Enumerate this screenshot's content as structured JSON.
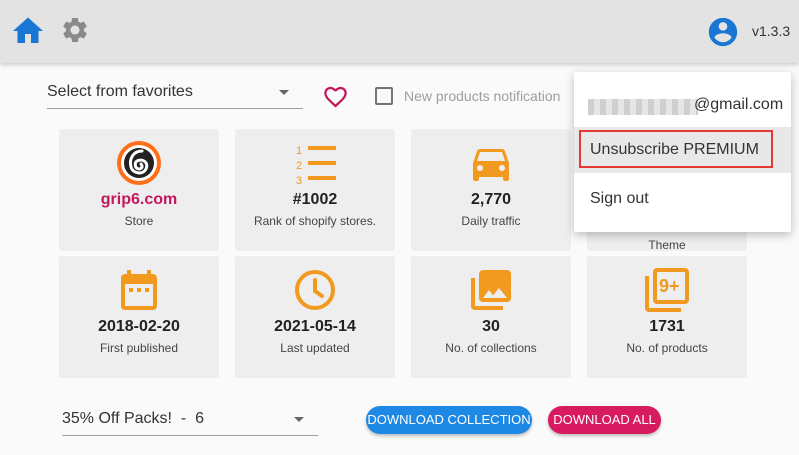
{
  "header": {
    "version": "v1.3.3",
    "accent": "#1976d2"
  },
  "toolbar": {
    "favorites_placeholder": "Select from favorites",
    "notification_label": "New products notification",
    "heart_color": "#c2185b"
  },
  "stats": {
    "store": {
      "value": "grip6.com",
      "label": "Store"
    },
    "rank": {
      "value": "#1002",
      "label": "Rank of shopify stores."
    },
    "traffic": {
      "value": "2,770",
      "label": "Daily traffic"
    },
    "theme": {
      "label": "Theme"
    },
    "published": {
      "value": "2018-02-20",
      "label": "First published"
    },
    "updated": {
      "value": "2021-05-14",
      "label": "Last updated"
    },
    "collections": {
      "value": "30",
      "label": "No. of collections"
    },
    "products": {
      "value": "1731",
      "label": "No. of products"
    },
    "icon_color": "#f29a1f"
  },
  "bottom": {
    "collection_select_value": "35% Off Packs!  -  6",
    "download_collection": "DOWNLOAD COLLECTION",
    "download_all": "DOWNLOAD ALL",
    "collection_btn_color": "#1e88e5",
    "all_btn_color": "#d81b60"
  },
  "menu": {
    "email_suffix": "@gmail.com",
    "unsubscribe": "Unsubscribe PREMIUM",
    "sign_out": "Sign out"
  },
  "icons": [
    "home-icon",
    "gear-icon",
    "account-icon",
    "heart-icon",
    "store-logo-icon",
    "list-numbered-icon",
    "car-icon",
    "calendar-icon",
    "clock-icon",
    "collections-icon",
    "products-9plus-icon"
  ]
}
